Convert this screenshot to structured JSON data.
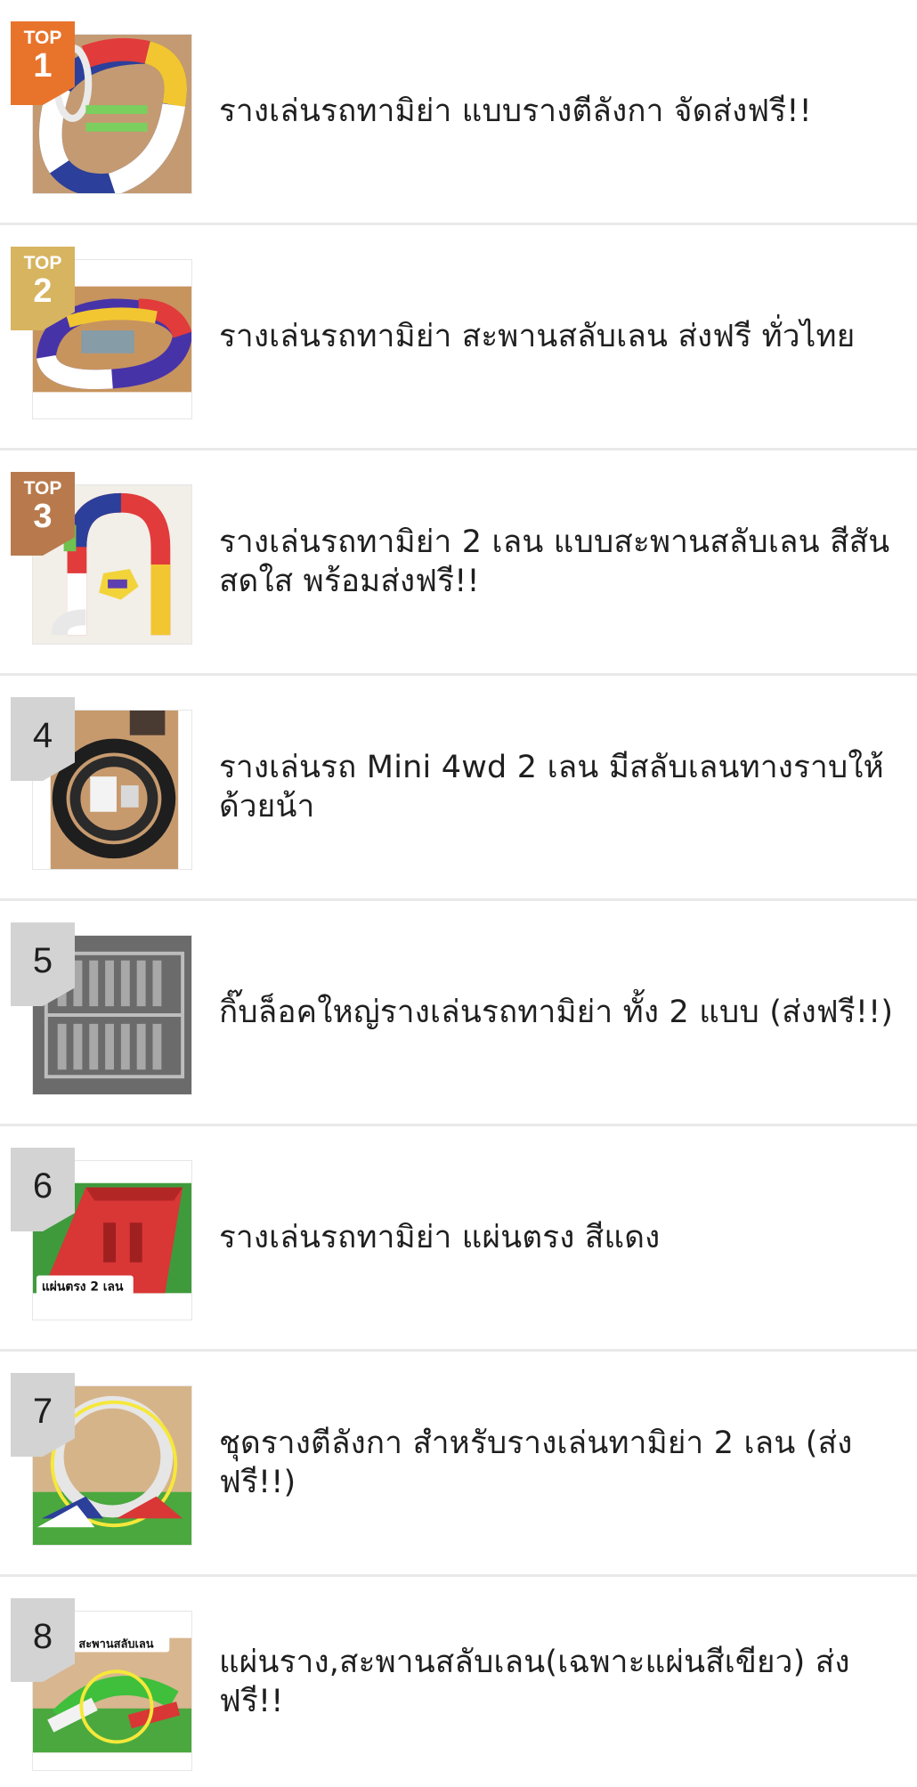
{
  "colors": {
    "top1": "#e8742c",
    "top2": "#d7b460",
    "top3": "#b87a4d",
    "plain": "#d3d3d3",
    "divider": "#e9e9e9"
  },
  "top_label": "TOP",
  "items": [
    {
      "rank": "1",
      "title": "รางเล่นรถทามิย่า แบบรางตีลังกา จัดส่งฟรี!!"
    },
    {
      "rank": "2",
      "title": "รางเล่นรถทามิย่า สะพานสลับเลน ส่งฟรี ทั่วไทย"
    },
    {
      "rank": "3",
      "title": "รางเล่นรถทามิย่า 2 เลน แบบสะพานสลับเลน สีสันสดใส พร้อมส่งฟรี!!"
    },
    {
      "rank": "4",
      "title": "รางเล่นรถ Mini 4wd 2 เลน  มีสลับเลนทางราบให้ด้วยน้า"
    },
    {
      "rank": "5",
      "title": "กิ๊บล็อคใหญ่รางเล่นรถทามิย่า ทั้ง 2 แบบ (ส่งฟรี!!)"
    },
    {
      "rank": "6",
      "title": "รางเล่นรถทามิย่า แผ่นตรง สีแดง",
      "image_caption": "แผ่นตรง 2 เลน"
    },
    {
      "rank": "7",
      "title": "ชุดรางตีลังกา สำหรับรางเล่นทามิย่า 2 เลน (ส่งฟรี!!)"
    },
    {
      "rank": "8",
      "title": "แผ่นราง,สะพานสลับเลน(เฉพาะแผ่นสีเขียว) ส่งฟรี!!",
      "image_caption": "สะพานสลับเลน"
    }
  ]
}
